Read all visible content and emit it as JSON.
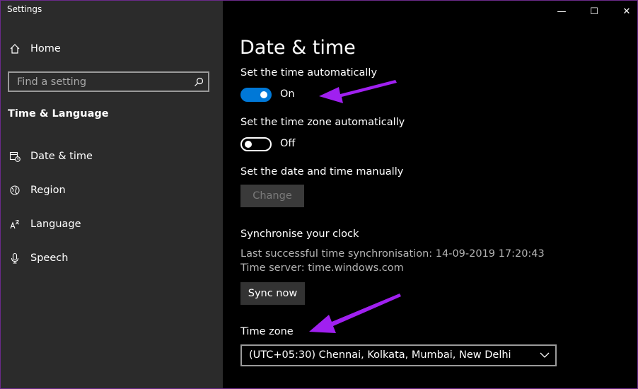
{
  "window": {
    "title": "Settings",
    "controls": {
      "minimize": "—",
      "maximize": "☐",
      "close": "✕"
    }
  },
  "sidebar": {
    "home_label": "Home",
    "search": {
      "placeholder": "Find a setting"
    },
    "section_heading": "Time & Language",
    "items": [
      {
        "label": "Date & time",
        "icon": "date-time-icon"
      },
      {
        "label": "Region",
        "icon": "globe-icon"
      },
      {
        "label": "Language",
        "icon": "language-icon"
      },
      {
        "label": "Speech",
        "icon": "microphone-icon"
      }
    ]
  },
  "main": {
    "page_title": "Date & time",
    "set_time_auto": {
      "label": "Set the time automatically",
      "state": "On",
      "enabled": true
    },
    "set_timezone_auto": {
      "label": "Set the time zone automatically",
      "state": "Off",
      "enabled": false
    },
    "manual": {
      "label": "Set the date and time manually",
      "button": "Change"
    },
    "sync": {
      "heading": "Synchronise your clock",
      "last_sync": "Last successful time synchronisation: 14-09-2019 17:20:43",
      "server": "Time server: time.windows.com",
      "button": "Sync now"
    },
    "timezone": {
      "label": "Time zone",
      "value": "(UTC+05:30) Chennai, Kolkata, Mumbai, New Delhi"
    }
  },
  "colors": {
    "sidebar_bg": "#2b2b2b",
    "main_bg": "#000000",
    "accent": "#0078d7",
    "annotation_arrow": "#a020f0"
  }
}
